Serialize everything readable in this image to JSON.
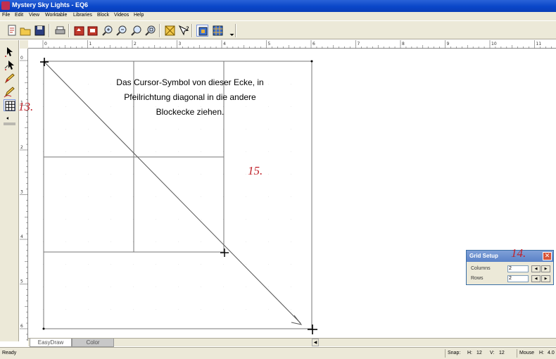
{
  "window": {
    "title": "Mystery Sky Lights - EQ6"
  },
  "menu": [
    "File",
    "Edit",
    "View",
    "Worktable",
    "Libraries",
    "Block",
    "Videos",
    "Help"
  ],
  "ruler": {
    "top_labels": [
      "0",
      "1",
      "2",
      "3",
      "4",
      "5",
      "6",
      "7",
      "8",
      "9",
      "10",
      "11"
    ],
    "left_labels": [
      "0",
      "1",
      "2",
      "3",
      "4",
      "5",
      "6"
    ]
  },
  "instruction": {
    "line1": "Das Cursor-Symbol von dieser Ecke, in",
    "line2": "Pfeilrichtung diagonal in die andere",
    "line3": "Blockecke ziehen."
  },
  "annotations": {
    "step13": "13.",
    "step14": "14.",
    "step15": "15."
  },
  "grid_setup": {
    "title": "Grid Setup",
    "columns_label": "Columns",
    "columns_value": "2",
    "rows_label": "Rows",
    "rows_value": "2"
  },
  "tabs": {
    "easydraw": "EasyDraw",
    "color": "Color"
  },
  "status": {
    "ready": "Ready",
    "snap_label": "Snap:",
    "h_label": "H:",
    "h_value": "12",
    "v_label": "V:",
    "v_value": "12",
    "mouse_label": "Mouse",
    "mouse_h_label": "H:",
    "mouse_h_value": "4.0"
  },
  "colors": {
    "titlebar": "#0a46c8",
    "annotation": "#c0222a",
    "chrome": "#ece9d8"
  }
}
